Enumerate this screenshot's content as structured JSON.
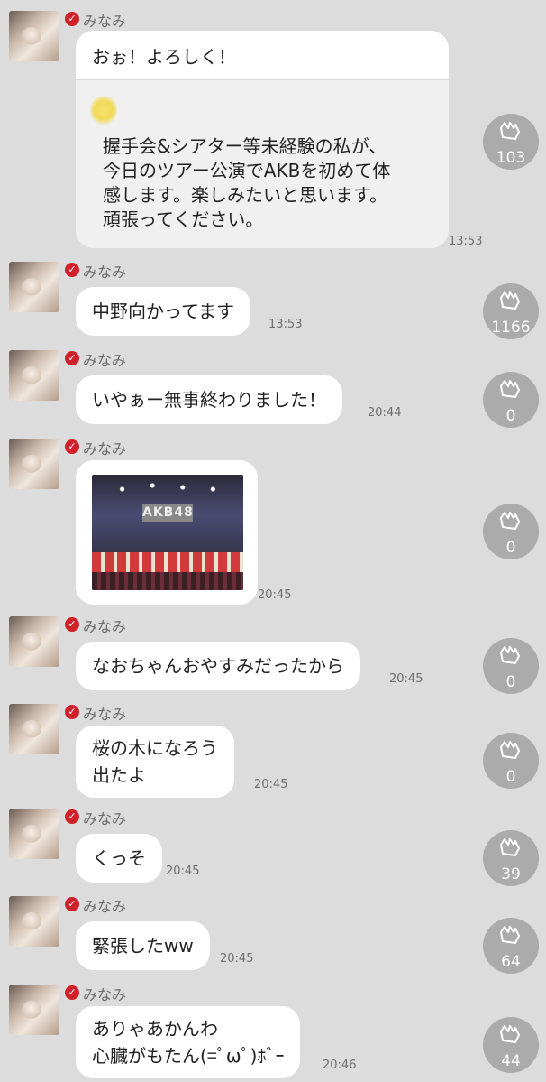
{
  "messages": [
    {
      "sender": "みなみ",
      "text": "おぉ！よろしく！",
      "quote_lines": [
        "握手会&シアター等未経験の私が、",
        "今日のツアー公演でAKBを初めて体",
        "感します。楽しみたいと思います。",
        "頑張ってください。"
      ],
      "time": "13:53",
      "claps": "103"
    },
    {
      "sender": "みなみ",
      "text": "中野向かってます",
      "time": "13:53",
      "claps": "1166"
    },
    {
      "sender": "みなみ",
      "text": "いやぁー無事終わりました！",
      "time": "20:44",
      "claps": "0"
    },
    {
      "sender": "みなみ",
      "photo_text": "AKB48",
      "time": "20:45",
      "claps": "0"
    },
    {
      "sender": "みなみ",
      "text": "なおちゃんおやすみだったから",
      "time": "20:45",
      "claps": "0"
    },
    {
      "sender": "みなみ",
      "lines": [
        "桜の木になろう",
        "出たよ"
      ],
      "time": "20:45",
      "claps": "0"
    },
    {
      "sender": "みなみ",
      "text": "くっそ",
      "time": "20:45",
      "claps": "39"
    },
    {
      "sender": "みなみ",
      "text": "緊張したww",
      "time": "20:45",
      "claps": "64"
    },
    {
      "sender": "みなみ",
      "lines": [
        "ありゃあかんわ",
        "心臓がもたん(=ﾟωﾟ)ﾎﾞｰ"
      ],
      "time": "20:46",
      "claps": "44"
    }
  ],
  "icons": {
    "clap": "clapping-hands-icon",
    "verified": "verified-check-icon"
  },
  "colors": {
    "background": "#dcdcdc",
    "bubble": "#ffffff",
    "clap_circle": "#ababab",
    "verified": "#d0202a"
  }
}
